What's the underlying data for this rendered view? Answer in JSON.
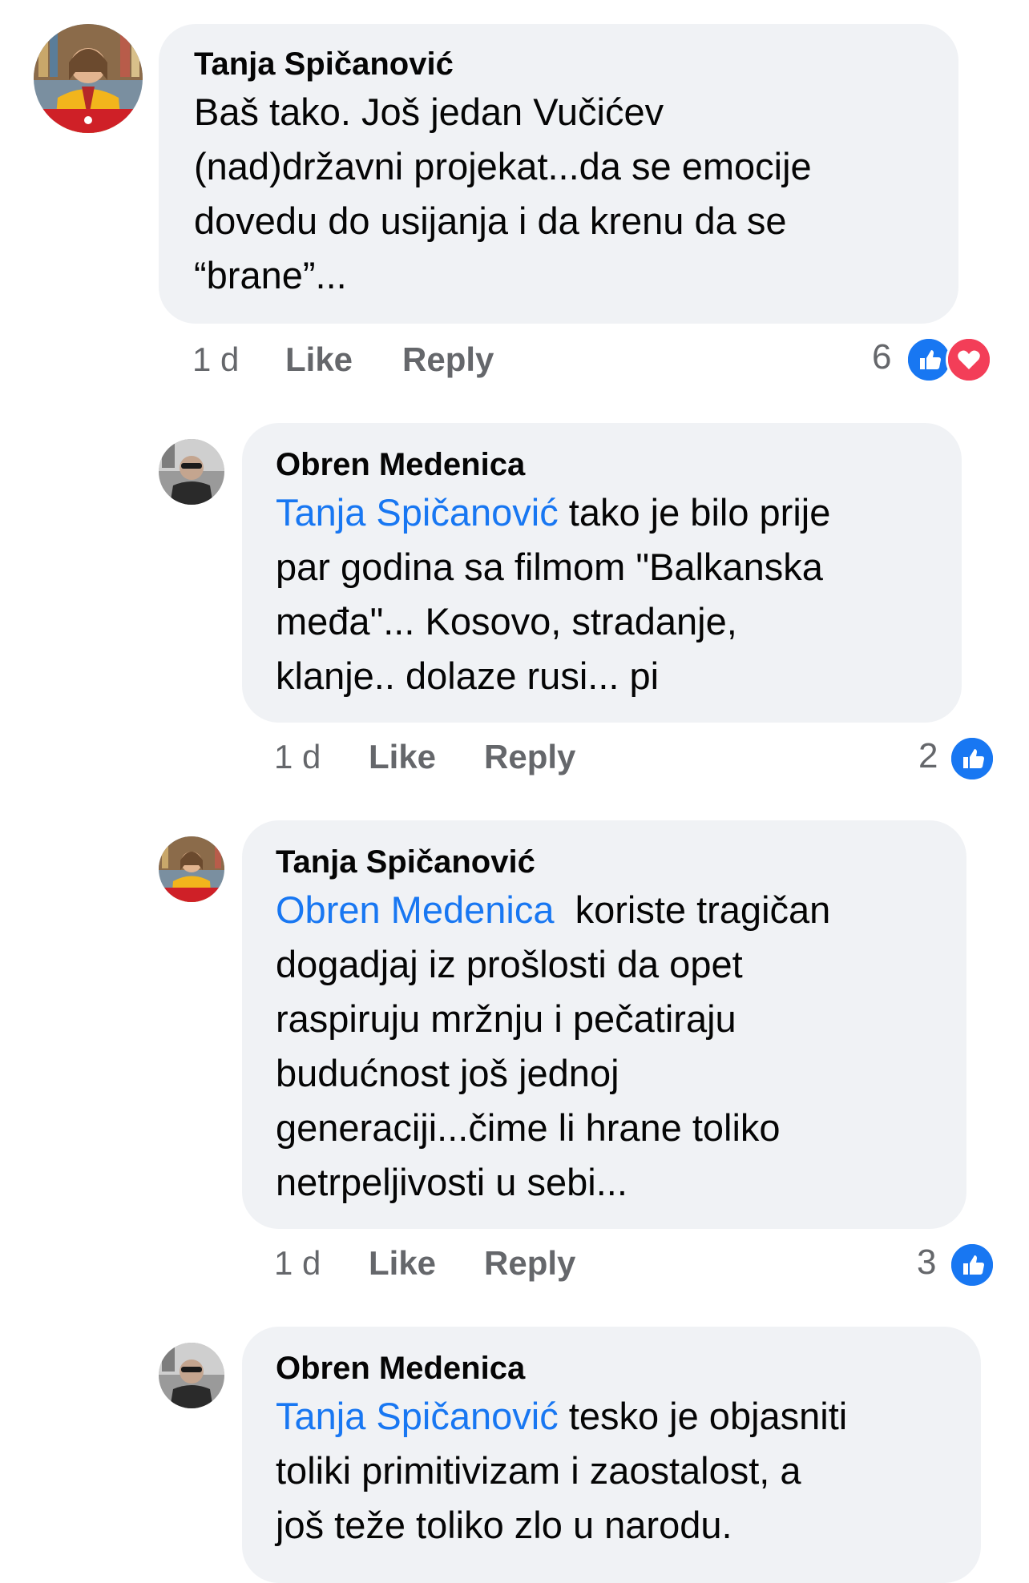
{
  "comments": [
    {
      "author": "Tanja Spičanović",
      "lines": [
        "Baš tako. Još jedan Vučićev",
        "(nad)državni projekat...da se emocije",
        "dovedu do usijanja i da krenu da se",
        "“brane”..."
      ],
      "time": "1 d",
      "like_label": "Like",
      "reply_label": "Reply",
      "reaction_count": "6",
      "reactions": [
        "like-icon",
        "love-icon"
      ]
    },
    {
      "author": "Obren Medenica",
      "mention": "Tanja Spičanović",
      "first_line_rest": " tako je bilo prije",
      "lines": [
        "par godina sa filmom \"Balkanska",
        "međa\"... Kosovo, stradanje,",
        "klanje..  dolaze rusi... pi"
      ],
      "time": "1 d",
      "like_label": "Like",
      "reply_label": "Reply",
      "reaction_count": "2",
      "reactions": [
        "like-icon"
      ]
    },
    {
      "author": "Tanja Spičanović",
      "mention": "Obren Medenica",
      "first_line_rest": "  koriste tragičan",
      "lines": [
        "dogadjaj iz prošlosti da opet",
        "raspiruju mržnju i pečatiraju",
        "budućnost još jednoj",
        "generaciji...čime li hrane toliko",
        "netrpeljivosti u sebi..."
      ],
      "time": "1 d",
      "like_label": "Like",
      "reply_label": "Reply",
      "reaction_count": "3",
      "reactions": [
        "like-icon"
      ]
    },
    {
      "author": "Obren Medenica",
      "mention": "Tanja Spičanović",
      "first_line_rest": " tesko je objasniti",
      "lines": [
        "toliki primitivizam i zaostalost, a",
        "još teže toliko zlo u narodu."
      ]
    }
  ],
  "colors": {
    "bubble": "#f0f2f5",
    "mention": "#1877f2",
    "meta": "#65676b",
    "like_reaction": "#1877f2",
    "love_reaction": "#f33e58"
  }
}
